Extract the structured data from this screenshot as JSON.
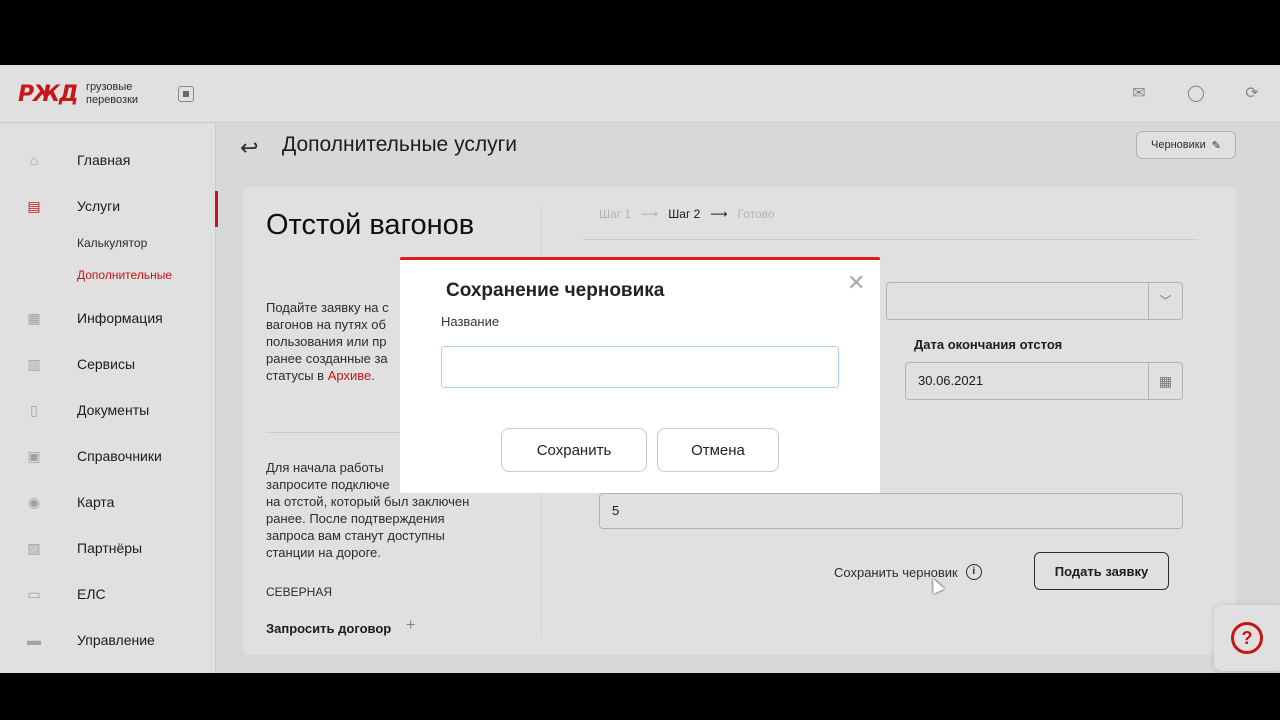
{
  "app": {
    "logo": "РЖД",
    "logo_text_line1": "грузовые",
    "logo_text_line2": "перевозки"
  },
  "topbar": {
    "icons": [
      "mail-icon",
      "user-icon",
      "logout-icon"
    ]
  },
  "sidebar": {
    "items": [
      {
        "label": "Главная",
        "icon": "home-icon"
      },
      {
        "label": "Услуги",
        "icon": "services-icon",
        "active": true
      },
      {
        "label": "Информация",
        "icon": "info-doc-icon"
      },
      {
        "label": "Сервисы",
        "icon": "chart-icon"
      },
      {
        "label": "Документы",
        "icon": "document-icon"
      },
      {
        "label": "Справочники",
        "icon": "handbook-icon"
      },
      {
        "label": "Карта",
        "icon": "map-pin-icon"
      },
      {
        "label": "Партнёры",
        "icon": "partners-icon"
      },
      {
        "label": "ЕЛС",
        "icon": "account-icon"
      },
      {
        "label": "Управление",
        "icon": "management-icon"
      }
    ],
    "sub_items": [
      {
        "label": "Калькулятор",
        "active": false
      },
      {
        "label": "Дополнительные",
        "active": true
      }
    ]
  },
  "header": {
    "title": "Дополнительные услуги",
    "drafts_label": "Черновики"
  },
  "card": {
    "title": "Отстой вагонов",
    "desc_lines": [
      "Подайте заявку на с",
      "вагонов на путях об",
      "пользования или пр",
      "ранее созданные за"
    ],
    "desc_last_prefix": "статусы в ",
    "desc_link": "Архиве",
    "desc_last_suffix": ".",
    "desc2_lines": [
      "Для начала работы",
      "запросите подключе",
      "на отстой, который был заключен",
      "ранее. После подтверждения",
      "запроса вам станут доступны",
      "станции на дороге."
    ],
    "region": "СЕВЕРНАЯ",
    "request_contract": "Запросить договор",
    "steps": {
      "step1": "Шаг 1",
      "step2": "Шаг 2",
      "step3": "Готово"
    },
    "end_date_label": "Дата окончания отстоя",
    "end_date_value": "30.06.2021",
    "quantity_value": "5",
    "save_draft_label": "Сохранить черновик",
    "submit_label": "Подать заявку"
  },
  "modal": {
    "title": "Сохранение черновика",
    "name_label": "Название",
    "name_value": "",
    "save_label": "Сохранить",
    "cancel_label": "Отмена"
  },
  "colors": {
    "accent": "#e21a1a",
    "input_focus": "#a9d3e8"
  }
}
